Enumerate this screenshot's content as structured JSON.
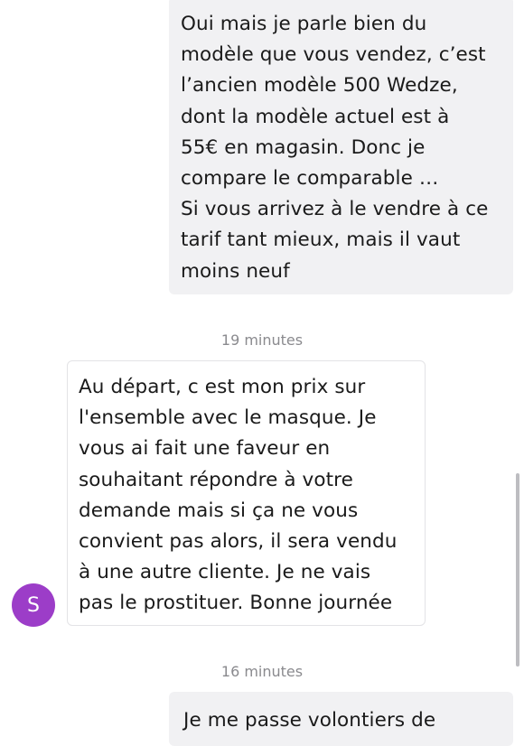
{
  "messages": [
    {
      "direction": "outgoing",
      "text": "Oui mais je parle bien du\nmodèle que vous vendez, c’est\nl’ancien modèle 500 Wedze,\ndont la modèle actuel est à\n55€ en magasin. Donc je\ncompare le comparable …\nSi vous arrivez à le vendre à ce\ntarif tant mieux, mais il vaut\nmoins neuf"
    },
    {
      "direction": "incoming",
      "text": "Au départ, c est mon prix sur\nl'ensemble avec le masque. Je\nvous ai fait une faveur en\nsouhaitant répondre à votre\ndemande mais si ça ne vous\nconvient pas alors, il sera vendu\nà une autre cliente. Je ne vais\npas le prostituer.  Bonne journée"
    },
    {
      "direction": "outgoing",
      "text": "Je me passe volontiers de"
    }
  ],
  "timestamps": [
    "19 minutes",
    "16 minutes"
  ],
  "avatar": {
    "initial": "S",
    "color": "#9c3dc8"
  }
}
